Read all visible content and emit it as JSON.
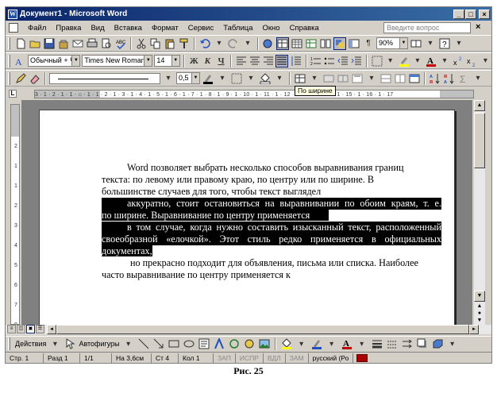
{
  "window": {
    "title": "Документ1 - Microsoft Word",
    "title_icon": "W",
    "min_glyph": "_",
    "max_glyph": "□",
    "close_glyph": "×"
  },
  "menu": {
    "items": [
      "Файл",
      "Правка",
      "Вид",
      "Вставка",
      "Формат",
      "Сервис",
      "Таблица",
      "Окно",
      "Справка"
    ],
    "help_placeholder": "Введите вопрос",
    "close_glyph": "×"
  },
  "standard_toolbar": {
    "zoom": "90%"
  },
  "format_toolbar": {
    "style": "Обычный + Чер",
    "font": "Times New Roman",
    "size": "14",
    "bold": "Ж",
    "italic": "К",
    "underline": "Ч"
  },
  "borders_toolbar": {
    "line_weight": "0,5"
  },
  "tooltip": "По ширине",
  "ruler": {
    "corner": "L",
    "horizontal": "3 · 1 · 2 · 1 · 1 · ⌂ · 1 · 1 · 2 · 1 · 3 · 1 · 4 · 1 · 5 · 1 · 6 · 1 · 7 · 1 · 8 · 1 · 9 · 1 · 10 · 1 · 11 · 1 · 12 · 1 · 13 · 1 · 14 · 1 · 15 · 1 · 16 · 1 · 17",
    "vertical": [
      "2",
      "1",
      "1",
      "2",
      "3",
      "4",
      "5",
      "6",
      "7",
      "8",
      "9"
    ]
  },
  "document": {
    "lines": [
      "Word позволяет выбрать несколько способов выравнивания границ",
      "текста: по левому или правому краю, по центру или по ширине. В",
      "большинстве случаев для того, чтобы текст выглядел",
      "аккуратно, стоит остановиться на выравнивании по обоим краям, т. е.",
      "по ширине. Выравнивание по центру применяется",
      "в том случае, когда нужно составить изысканный текст, расположенный",
      "своеобразной «елочкой». Этот стиль редко применяется в официальных",
      "документах,",
      "но прекрасно подходит для объявления, письма или списка. Наиболее",
      "часто выравнивание по центру применяется к"
    ]
  },
  "drawing_toolbar": {
    "actions": "Действия",
    "autoshapes": "Автофигуры"
  },
  "status": {
    "page": "Стр. 1",
    "section": "Разд 1",
    "pages": "1/1",
    "position": "На 3,6см",
    "line": "Ст 4",
    "column": "Кол 1",
    "rec": "ЗАП",
    "trk": "ИСПР",
    "ext": "ВДЛ",
    "ovr": "ЗАМ",
    "language": "русский (Ро"
  },
  "caption": "Рис. 25"
}
